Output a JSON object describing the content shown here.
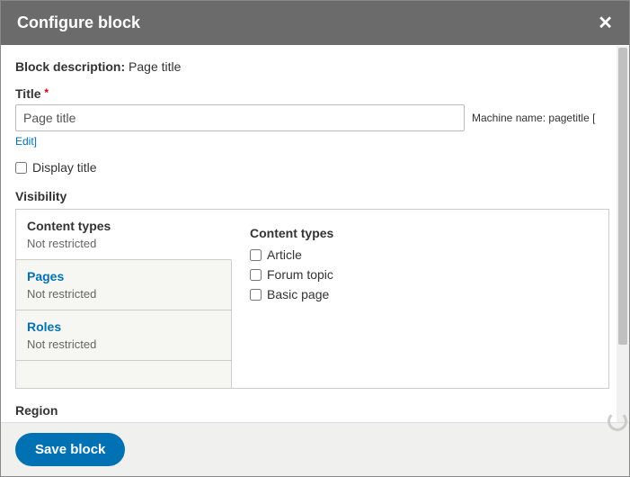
{
  "header": {
    "title": "Configure block"
  },
  "description": {
    "label": "Block description",
    "value": "Page title"
  },
  "title_field": {
    "label": "Title",
    "value": "Page title",
    "machine_name_label": "Machine name:",
    "machine_name_value": "pagetitle [",
    "edit_label": "Edit]"
  },
  "display_title": {
    "label": "Display title"
  },
  "visibility": {
    "label": "Visibility",
    "tabs": [
      {
        "title": "Content types",
        "sub": "Not restricted"
      },
      {
        "title": "Pages",
        "sub": "Not restricted"
      },
      {
        "title": "Roles",
        "sub": "Not restricted"
      }
    ],
    "content_types": {
      "heading": "Content types",
      "items": [
        "Article",
        "Forum topic",
        "Basic page"
      ]
    }
  },
  "region": {
    "label": "Region"
  },
  "footer": {
    "save": "Save block"
  }
}
